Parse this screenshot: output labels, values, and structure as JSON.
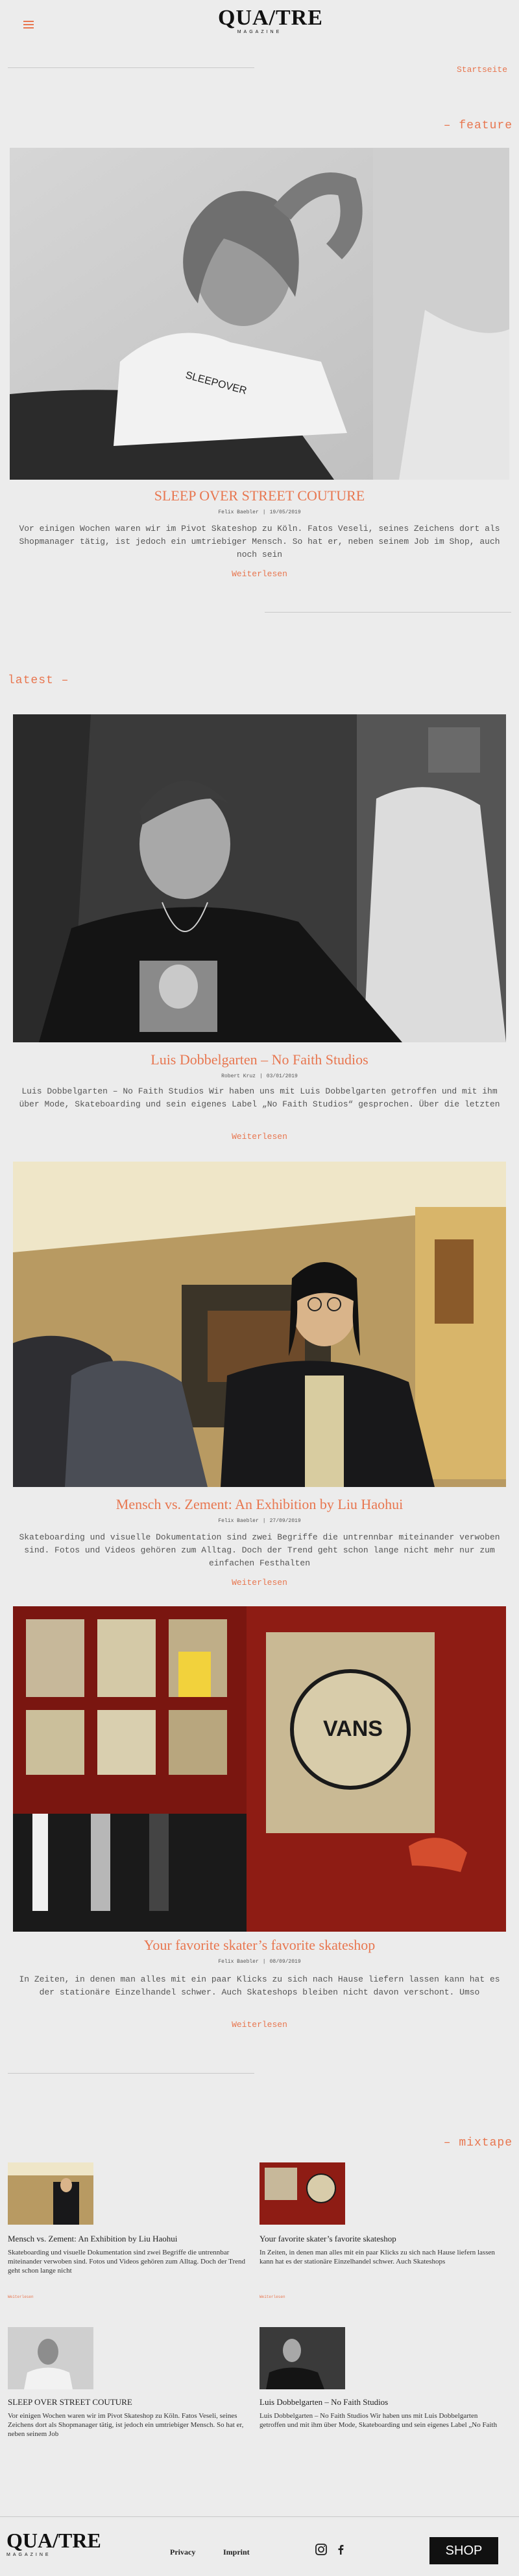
{
  "header": {
    "logo_main": "QUA/TRE",
    "logo_sub": "MAGAZINE",
    "startseite": "Startseite"
  },
  "featured": {
    "label": "– feature",
    "title": "SLEEP OVER STREET COUTURE",
    "author": "Felix Baebler",
    "date": "19/05/2019",
    "excerpt": "Vor einigen Wochen waren wir im Pivot Skateshop zu Köln. Fatos Veseli, seines Zeichens dort als Shopmanager tätig, ist jedoch ein umtriebiger Mensch. So hat er, neben seinem Job im Shop, auch noch sein",
    "read_more": "Weiterlesen"
  },
  "latest": {
    "label": "latest –",
    "posts": [
      {
        "title": "Luis Dobbelgarten – No Faith Studios",
        "author": "Robert Kruz",
        "date": "03/01/2019",
        "excerpt": "Luis Dobbelgarten – No Faith Studios Wir haben uns mit Luis Dobbelgarten getroffen und mit ihm über Mode, Skateboarding und sein eigenes Label „No Faith Studios“ gesprochen. Über die letzten",
        "read_more": "Weiterlesen"
      },
      {
        "title": "Mensch vs. Zement: An Exhibition by Liu Haohui",
        "author": "Felix Baebler",
        "date": "27/09/2019",
        "excerpt": "Skateboarding und visuelle Dokumentation sind zwei Begriffe die untrennbar miteinander verwoben sind. Fotos und Videos gehören zum Alltag. Doch der Trend geht schon lange nicht mehr nur zum einfachen Festhalten",
        "read_more": "Weiterlesen"
      },
      {
        "title": "Your favorite skater’s favorite skateshop",
        "author": "Felix Baebler",
        "date": "08/09/2019",
        "excerpt": "In Zeiten, in denen man alles mit ein paar Klicks zu sich nach Hause liefern lassen kann hat es der stationäre Einzelhandel schwer. Auch Skateshops bleiben nicht davon verschont. Umso",
        "read_more": "Weiterlesen"
      }
    ]
  },
  "mixtape": {
    "label": "– mixtape",
    "items": [
      {
        "title": "Mensch vs. Zement: An Exhibition by Liu Haohui",
        "text": "Skateboarding und visuelle Dokumentation sind zwei Begriffe die untrennbar miteinander verwoben sind. Fotos und Videos gehören zum Alltag. Doch der Trend geht schon lange nicht",
        "meta": "Weiterlesen"
      },
      {
        "title": "Your favorite skater’s favorite skateshop",
        "text": "In Zeiten, in denen man alles mit ein paar Klicks zu sich nach Hause liefern lassen kann hat es der stationäre Einzelhandel schwer. Auch Skateshops",
        "meta": "Weiterlesen"
      },
      {
        "title": "SLEEP OVER STREET COUTURE",
        "text": "Vor einigen Wochen waren wir im Pivot Skateshop zu Köln. Fatos Veseli, seines Zeichens dort als Shopmanager tätig, ist jedoch ein umtriebiger Mensch. So hat er, neben seinem Job",
        "meta": "Weiterlesen"
      },
      {
        "title": "Luis Dobbelgarten – No Faith Studios",
        "text": "Luis Dobbelgarten – No Faith Studios Wir haben uns mit Luis Dobbelgarten getroffen und mit ihm über Mode, Skateboarding und sein eigenes Label „No Faith",
        "meta": "Weiterlesen"
      }
    ]
  },
  "footer": {
    "logo_main": "QUA/TRE",
    "logo_sub": "MAGAZINE",
    "privacy": "Privacy",
    "imprint": "Imprint",
    "shop": "SHOP",
    "icons": [
      "instagram-icon",
      "facebook-icon"
    ]
  },
  "colors": {
    "accent": "#e8764f",
    "background": "#ececec",
    "shop_button": "#111111"
  }
}
